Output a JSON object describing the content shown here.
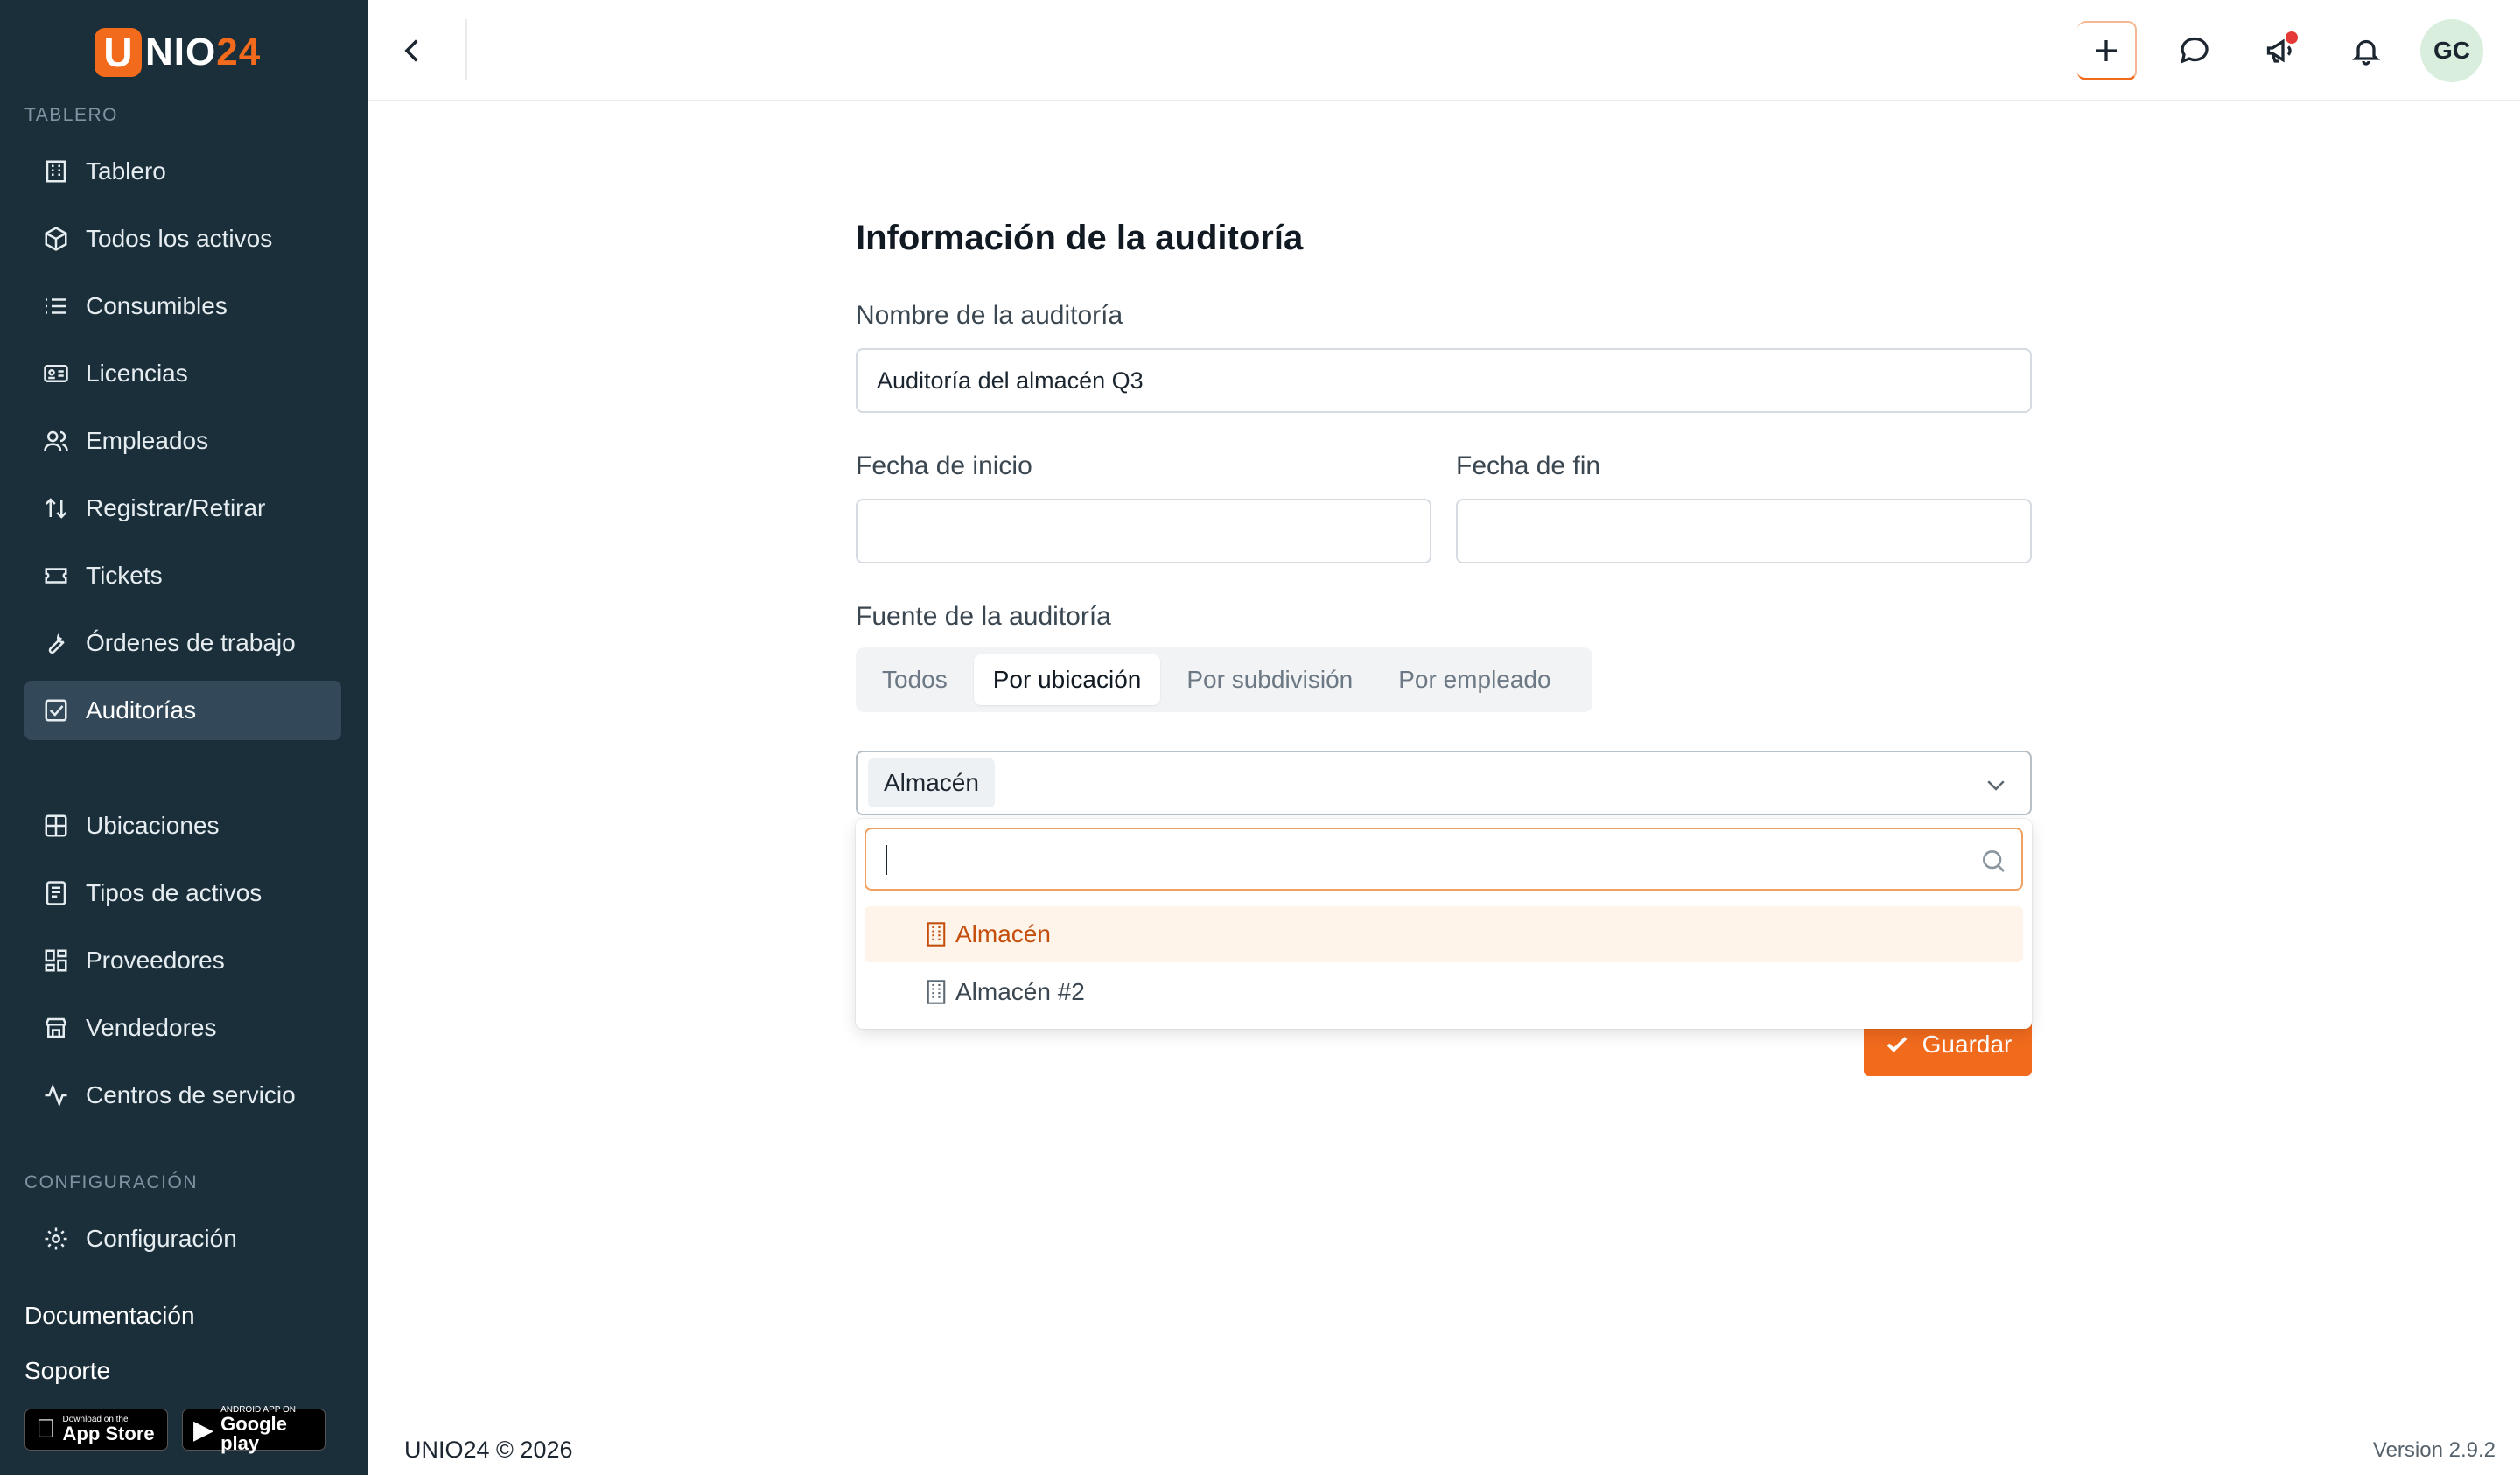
{
  "brand": {
    "logo_u": "U",
    "logo_text": "NIO",
    "logo_num": "24",
    "accent": "#f26b1d",
    "sidebar_bg": "#1b2f3b"
  },
  "sidebar": {
    "section_main": "TABLERO",
    "items": [
      {
        "label": "Tablero",
        "icon": "building-icon"
      },
      {
        "label": "Todos los activos",
        "icon": "box-icon"
      },
      {
        "label": "Consumibles",
        "icon": "list-icon"
      },
      {
        "label": "Licencias",
        "icon": "id-card-icon"
      },
      {
        "label": "Empleados",
        "icon": "users-icon"
      },
      {
        "label": "Registrar/Retirar",
        "icon": "arrows-updown-icon"
      },
      {
        "label": "Tickets",
        "icon": "ticket-icon"
      },
      {
        "label": "Órdenes de trabajo",
        "icon": "wrench-icon"
      },
      {
        "label": "Auditorías",
        "icon": "checkbox-icon",
        "active": true
      }
    ],
    "items2": [
      {
        "label": "Ubicaciones",
        "icon": "grid-icon"
      },
      {
        "label": "Tipos de activos",
        "icon": "document-icon"
      },
      {
        "label": "Proveedores",
        "icon": "dashboard-icon"
      },
      {
        "label": "Vendedores",
        "icon": "store-icon"
      },
      {
        "label": "Centros de servicio",
        "icon": "activity-icon"
      }
    ],
    "section_config": "CONFIGURACIÓN",
    "config_item": {
      "label": "Configuración",
      "icon": "gear-icon"
    },
    "documentation": "Documentación",
    "support": "Soporte",
    "app_store": {
      "small": "Download on the",
      "big": "App Store"
    },
    "google_play": {
      "small": "ANDROID APP ON",
      "big": "Google play"
    }
  },
  "header": {
    "avatar_initials": "GC",
    "has_notification_dot": true
  },
  "form": {
    "title": "Información de la auditoría",
    "name_label": "Nombre de la auditoría",
    "name_value": "Auditoría del almacén Q3",
    "start_label": "Fecha de inicio",
    "start_value": "",
    "end_label": "Fecha de fin",
    "end_value": "",
    "source_label": "Fuente de la auditoría",
    "source_tabs": [
      "Todos",
      "Por ubicación",
      "Por subdivisión",
      "Por empleado"
    ],
    "source_active": "Por ubicación",
    "selected_location": "Almacén",
    "search_value": "",
    "options": [
      "Almacén",
      "Almacén #2"
    ],
    "save_label": "Guardar"
  },
  "footer": {
    "copyright": "UNIO24 © 2026",
    "version": "Version 2.9.2"
  }
}
